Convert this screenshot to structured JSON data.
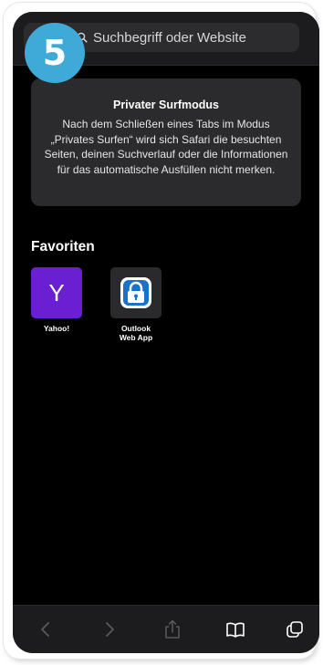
{
  "step_badge": "5",
  "search": {
    "placeholder": "Suchbegriff oder Website"
  },
  "private_mode": {
    "title": "Privater Surfmodus",
    "text": "Nach dem Schließen eines Tabs im Modus „Privates Surfen“ wird sich Safari die besuchten Seiten, deinen Suchverlauf oder die Informationen für das automatische Ausfüllen nicht merken."
  },
  "favorites": {
    "heading": "Favoriten",
    "items": [
      {
        "label": "Yahoo!",
        "tile_text": "Y",
        "icon": "yahoo-logo",
        "color": "#6a1fd3"
      },
      {
        "label": "Outlook Web App",
        "icon": "padlock-icon",
        "color": "#2a2a2c"
      }
    ]
  },
  "toolbar": {
    "buttons": [
      {
        "icon": "back-chevron-icon",
        "enabled": false
      },
      {
        "icon": "forward-chevron-icon",
        "enabled": false
      },
      {
        "icon": "share-icon",
        "enabled": false
      },
      {
        "icon": "bookmarks-icon",
        "enabled": true
      },
      {
        "icon": "tabs-icon",
        "enabled": true
      }
    ]
  },
  "colors": {
    "background": "#000000",
    "bar": "#1c1c1e",
    "card": "#2b2b2d",
    "badge": "#3fa9d8",
    "disabled_icon": "#5a5a5e",
    "enabled_icon": "#ffffff"
  }
}
